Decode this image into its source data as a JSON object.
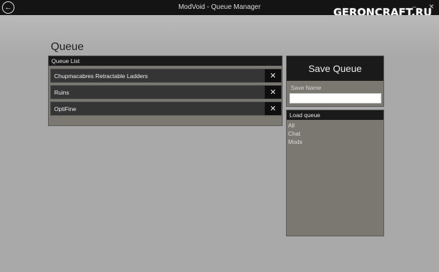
{
  "window": {
    "title": "ModVoid - Queue Manager",
    "back_icon": "arrow-left-circle-icon",
    "minimize_icon": "minimize-icon",
    "close_icon": "close-icon",
    "watermark": "GERONCRAFT.RU"
  },
  "page": {
    "heading": "Queue"
  },
  "queue_list": {
    "header": "Queue List",
    "items": [
      {
        "label": "Chupmacabres Retractable Ladders",
        "remove": "✕"
      },
      {
        "label": "Ruins",
        "remove": "✕"
      },
      {
        "label": "OptiFine",
        "remove": "✕"
      }
    ]
  },
  "save": {
    "button_label": "Save Queue",
    "name_label": "Save Name",
    "name_value": ""
  },
  "load": {
    "header": "Load queue",
    "items": [
      "All",
      "Chat",
      "Mods"
    ]
  },
  "colors": {
    "background": "#a9a9a9",
    "titlebar": "#141414",
    "panel": "#7b7872",
    "header": "#1a1a1a",
    "item": "#353535"
  }
}
